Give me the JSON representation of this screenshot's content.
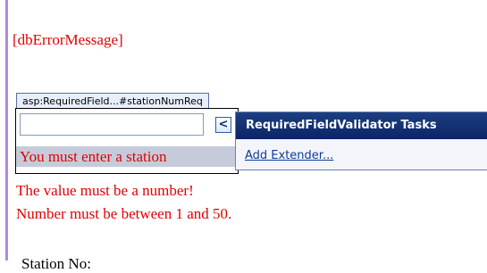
{
  "design_surface": {
    "error_placeholder": "[dbErrorMessage]",
    "selected_control_tag": "asp:RequiredField...#stationNumReq",
    "required_message_visible": "You must enter a station",
    "number_message": "The value must be a number!",
    "range_message": "Number must be between 1 and 50.",
    "cut_off_text": "Station No:"
  },
  "smart_tag": {
    "button_glyph": "<",
    "title": "RequiredFieldValidator Tasks",
    "actions": [
      {
        "label": "Add Extender..."
      }
    ]
  },
  "colors": {
    "validation_red": "#e00000",
    "tasks_header": "#0a2565",
    "link_blue": "#0b3c99",
    "selection_highlight": "#c6cbdb",
    "left_rule": "#b18ad8"
  }
}
